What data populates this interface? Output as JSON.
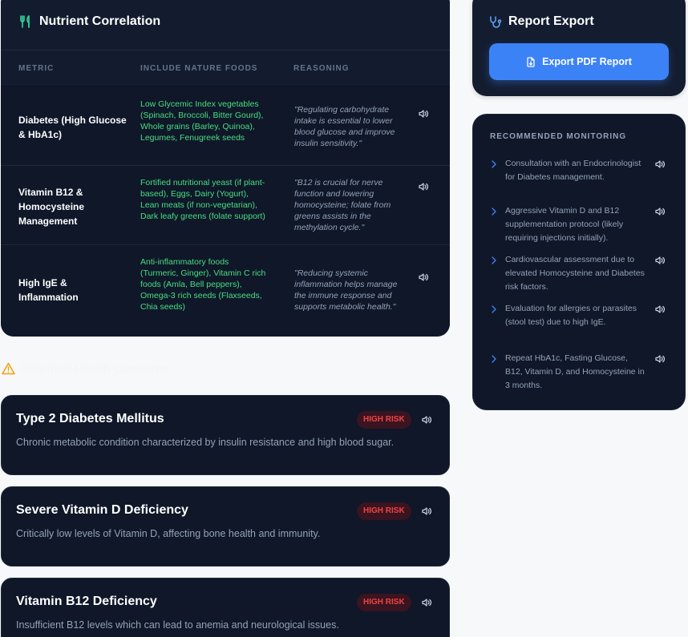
{
  "nutrient": {
    "title": "Nutrient Correlation",
    "headers": {
      "metric": "METRIC",
      "foods": "INCLUDE NATURE FOODS",
      "reasoning": "REASONING"
    },
    "rows": [
      {
        "metric": "Diabetes (High Glucose & HbA1c)",
        "foods": "Low Glycemic Index vegetables (Spinach, Broccoli, Bitter Gourd), Whole grains (Barley, Quinoa), Legumes, Fenugreek seeds",
        "reasoning": "\"Regulating carbohydrate intake is essential to lower blood glucose and improve insulin sensitivity.\""
      },
      {
        "metric": "Vitamin B12 & Homocysteine Management",
        "foods": "Fortified nutritional yeast (if plant-based), Eggs, Dairy (Yogurt), Lean meats (if non-vegetarian), Dark leafy greens (folate support)",
        "reasoning": "\"B12 is crucial for nerve function and lowering homocysteine; folate from greens assists in the methylation cycle.\""
      },
      {
        "metric": "High IgE & Inflammation",
        "foods": "Anti-inflammatory foods (Turmeric, Ginger), Vitamin C rich foods (Amla, Bell peppers), Omega-3 rich seeds (Flaxseeds, Chia seeds)",
        "reasoning": "\"Reducing systemic inflammation helps manage the immune response and supports metabolic health.\""
      }
    ]
  },
  "concerns": {
    "heading": "Potential Health Concerns",
    "items": [
      {
        "name": "Type 2 Diabetes Mellitus",
        "badge": "HIGH RISK",
        "description": "Chronic metabolic condition characterized by insulin resistance and high blood sugar."
      },
      {
        "name": "Severe Vitamin D Deficiency",
        "badge": "HIGH RISK",
        "description": "Critically low levels of Vitamin D, affecting bone health and immunity."
      },
      {
        "name": "Vitamin B12 Deficiency",
        "badge": "HIGH RISK",
        "description": "Insufficient B12 levels which can lead to anemia and neurological issues."
      }
    ]
  },
  "export": {
    "title": "Report Export",
    "button_label": "Export PDF Report"
  },
  "monitoring": {
    "title": "RECOMMENDED MONITORING",
    "items": [
      "Consultation with an Endocrinologist for Diabetes management.",
      "Aggressive Vitamin D and B12 supplementation protocol (likely requiring injections initially).",
      "Cardiovascular assessment due to elevated Homocysteine and Diabetes risk factors.",
      "Evaluation for allergies or parasites (stool test) due to high IgE.",
      "Repeat HbA1c, Fasting Glucose, B12, Vitamin D, and Homocysteine in 3 months."
    ]
  },
  "colors": {
    "accent": "#3b82f6",
    "food_green": "#4ade80",
    "risk_red": "#ef4444",
    "card_bg": "#0f1729",
    "warning": "#f59e0b"
  }
}
